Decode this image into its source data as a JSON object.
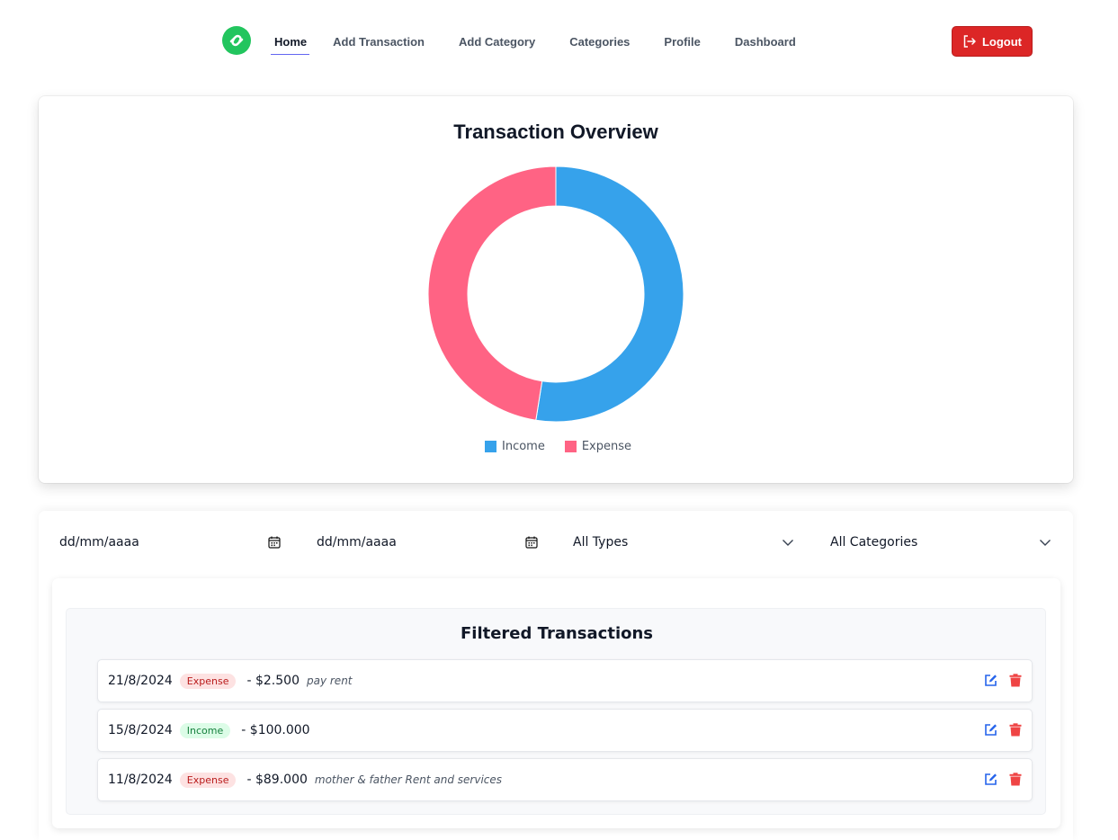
{
  "nav": {
    "logo_icon": "link-circle-icon",
    "items": [
      {
        "label": "Home",
        "active": true
      },
      {
        "label": "Add Transaction",
        "active": false
      },
      {
        "label": "Add Category",
        "active": false
      },
      {
        "label": "Categories",
        "active": false
      },
      {
        "label": "Profile",
        "active": false
      },
      {
        "label": "Dashboard",
        "active": false
      }
    ],
    "logout_label": "Logout",
    "logout_icon": "logout-icon"
  },
  "overview": {
    "title": "Transaction Overview",
    "chart_data": {
      "type": "pie",
      "donut": true,
      "categories": [
        "Income",
        "Expense"
      ],
      "values": [
        52.5,
        47.5
      ],
      "colors": [
        "#36a2eb",
        "#ff6384"
      ],
      "title": "",
      "legend": "bottom"
    }
  },
  "filters": {
    "start_date": "dd/mm/aaaa",
    "end_date": "dd/mm/aaaa",
    "type_select": "All Types",
    "category_select": "All Categories"
  },
  "transactions": {
    "title": "Filtered Transactions",
    "rows": [
      {
        "date": "21/8/2024",
        "type": "Expense",
        "amount": "- $2.500",
        "description": "pay rent"
      },
      {
        "date": "15/8/2024",
        "type": "Income",
        "amount": "- $100.000",
        "description": ""
      },
      {
        "date": "11/8/2024",
        "type": "Expense",
        "amount": "- $89.000",
        "description": "mother & father Rent and services"
      }
    ]
  },
  "colors": {
    "accent": "#6366f1",
    "logout": "#dc2626",
    "logo": "#22c55e",
    "edit": "#2563eb",
    "delete": "#ef4444"
  }
}
